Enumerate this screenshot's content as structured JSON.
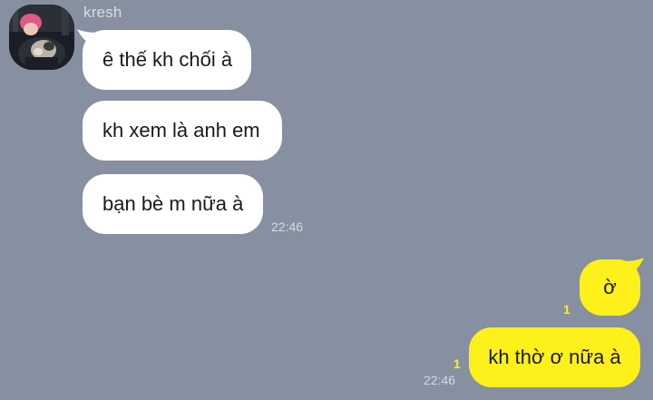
{
  "contact": {
    "name": "kresh",
    "avatar_icon": "profile-photo"
  },
  "incoming": [
    {
      "text": "ê thế kh chối à"
    },
    {
      "text": "kh xem là anh em"
    },
    {
      "text": "bạn bè m nữa à",
      "time": "22:46"
    }
  ],
  "outgoing": [
    {
      "text": "ờ",
      "unread": "1"
    },
    {
      "text": "kh thờ ơ nữa à",
      "unread": "1",
      "time": "22:46"
    }
  ],
  "colors": {
    "background": "#8690a1",
    "incoming_bubble": "#ffffff",
    "outgoing_bubble": "#fef01b",
    "unread_count": "#fef01b"
  }
}
